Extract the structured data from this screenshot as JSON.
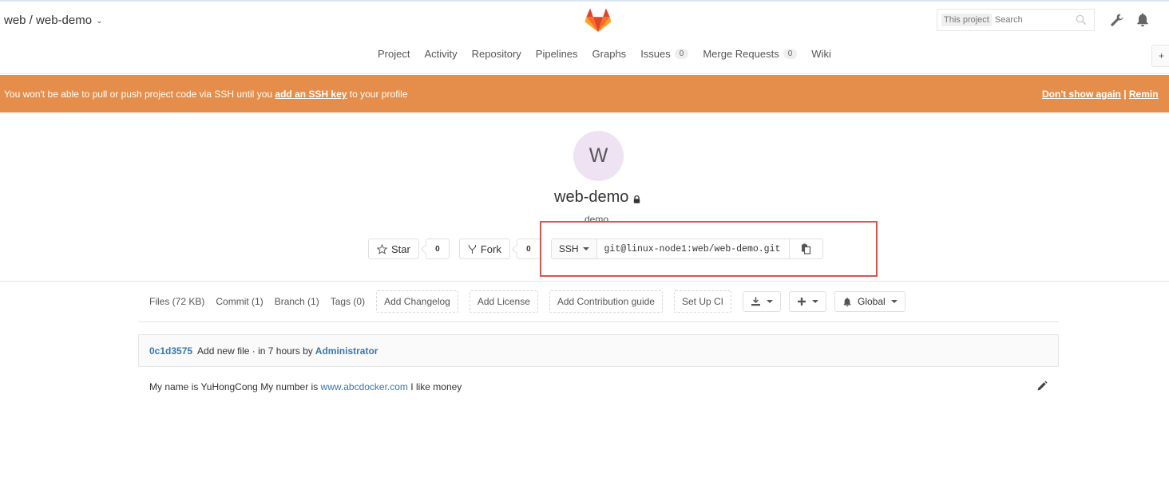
{
  "header": {
    "project_path": "web / web-demo",
    "search_scope": "This project",
    "search_placeholder": "Search"
  },
  "nav": {
    "items": [
      {
        "label": "Project"
      },
      {
        "label": "Activity"
      },
      {
        "label": "Repository"
      },
      {
        "label": "Pipelines"
      },
      {
        "label": "Graphs"
      },
      {
        "label": "Issues",
        "count": "0"
      },
      {
        "label": "Merge Requests",
        "count": "0"
      },
      {
        "label": "Wiki"
      }
    ]
  },
  "banner": {
    "message_before": "You won't be able to pull or push project code via SSH until you ",
    "link_text": "add an SSH key",
    "message_after": " to your profile",
    "dont_show": "Don't show again",
    "separator": " | ",
    "remind": "Remin",
    "color": "#e58e4b"
  },
  "project": {
    "avatar_letter": "W",
    "name": "web-demo",
    "description": "demo",
    "star_label": "Star",
    "star_count": "0",
    "fork_label": "Fork",
    "fork_count": "0",
    "clone_protocol": "SSH",
    "clone_url": "git@linux-node1:web/web-demo.git"
  },
  "stats": {
    "files": "Files (72 KB)",
    "commits": "Commit (1)",
    "branches": "Branch (1)",
    "tags": "Tags (0)",
    "add_changelog": "Add Changelog",
    "add_license": "Add License",
    "add_contribution": "Add Contribution guide",
    "setup_ci": "Set Up CI",
    "notification_level": "Global"
  },
  "commit": {
    "sha": "0c1d3575",
    "message": "Add new file · in 7 hours by",
    "author": "Administrator"
  },
  "readme": {
    "text_before": "My name is YuHongCong My number is ",
    "link": "www.abcdocker.com",
    "text_after": " I like money"
  },
  "colors": {
    "link": "#3777b0",
    "highlight_box": "#d9534f",
    "avatar_bg": "#eee2f3"
  }
}
